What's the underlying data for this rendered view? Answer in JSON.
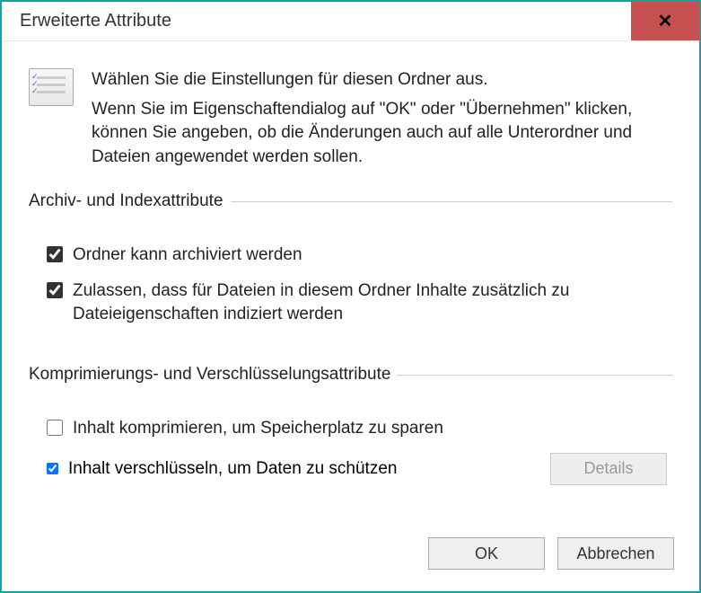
{
  "window": {
    "title": "Erweiterte Attribute",
    "close_glyph": "✕"
  },
  "header": {
    "heading": "Wählen Sie die Einstellungen für diesen Ordner aus.",
    "body": "Wenn Sie im Eigenschaftendialog auf \"OK\" oder \"Übernehmen\" klicken, können Sie angeben, ob die Änderungen auch auf alle Unterordner und Dateien angewendet werden sollen."
  },
  "groups": {
    "archive": {
      "legend": "Archiv- und Indexattribute",
      "archive_label": "Ordner kann archiviert werden",
      "archive_checked": true,
      "index_label": "Zulassen, dass für Dateien in diesem Ordner Inhalte zusätzlich zu Dateieigenschaften indiziert werden",
      "index_checked": true
    },
    "compress": {
      "legend": "Komprimierungs- und Verschlüsselungsattribute",
      "compress_label": "Inhalt komprimieren, um Speicherplatz zu sparen",
      "compress_checked": false,
      "encrypt_label": "Inhalt verschlüsseln, um Daten zu schützen",
      "encrypt_checked": true,
      "details_label": "Details",
      "details_enabled": false
    }
  },
  "buttons": {
    "ok": "OK",
    "cancel": "Abbrechen"
  }
}
